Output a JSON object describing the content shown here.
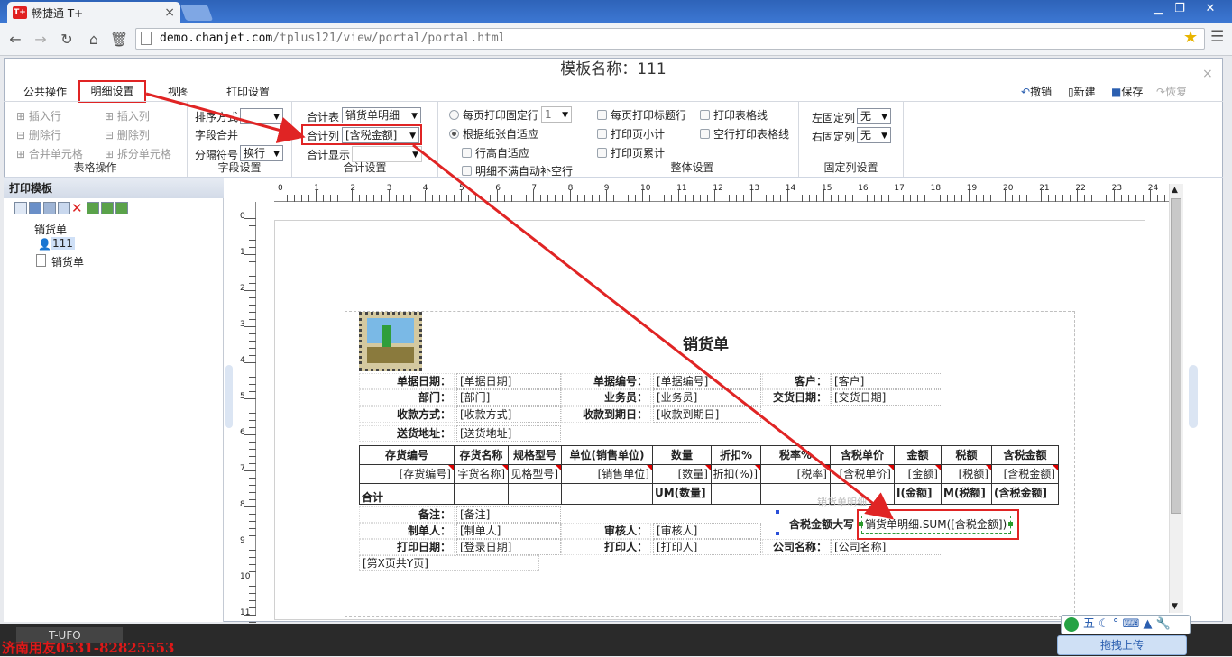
{
  "browser": {
    "tab_title": "畅捷通 T+",
    "tab_logo": "T+",
    "url_domain": "demo.chanjet.com",
    "url_path": "/tplus121/view/portal/portal.html",
    "window_controls": [
      "▁",
      "❐",
      "✕"
    ]
  },
  "app": {
    "title": "模板名称：111",
    "close": "×",
    "menu": [
      "公共操作",
      "明细设置",
      "视图",
      "打印设置"
    ],
    "actions": [
      "撤销",
      "新建",
      "保存",
      "恢复"
    ],
    "table_ops": {
      "items": [
        "插入行",
        "插入列",
        "删除行",
        "删除列",
        "合并单元格",
        "拆分单元格"
      ],
      "group": "表格操作"
    },
    "field_settings": {
      "sort_label": "排序方式",
      "sort_value": "",
      "merge_label": "字段合并",
      "sep_label": "分隔符号",
      "sep_value": "换行",
      "group": "字段设置"
    },
    "total_settings": {
      "table_label": "合计表",
      "table_value": "销货单明细",
      "col_label": "合计列",
      "col_value": "[含税金额]",
      "disp_label": "合计显示",
      "disp_value": "",
      "group": "合计设置"
    },
    "page_options": {
      "fixed_rows_label": "每页打印固定行",
      "fixed_rows_value": "1",
      "adapt_label": "根据纸张自适应",
      "row_height_label": "行高自适应",
      "fill_label": "明细不满自动补空行"
    },
    "overall": {
      "items": [
        "每页打印标题行",
        "打印表格线",
        "打印页小计",
        "空行打印表格线",
        "打印页累计"
      ],
      "group": "整体设置"
    },
    "fixed_cols": {
      "left_label": "左固定列",
      "left_value": "无",
      "right_label": "右固定列",
      "right_value": "无",
      "group": "固定列设置"
    }
  },
  "left_panel": {
    "title": "打印模板",
    "tree": [
      "销货单",
      "111",
      "销货单"
    ]
  },
  "ruler": {
    "h": [
      "0",
      "1",
      "2",
      "3",
      "4",
      "5",
      "6",
      "7",
      "8",
      "9",
      "10",
      "11",
      "12",
      "13",
      "14",
      "15",
      "16",
      "17",
      "18",
      "19",
      "20",
      "21",
      "22",
      "23",
      "24"
    ],
    "v": [
      "0",
      "1",
      "2",
      "3",
      "4",
      "5",
      "6",
      "7",
      "8",
      "9",
      "10",
      "11"
    ]
  },
  "doc": {
    "title": "销货单",
    "header_rows": [
      [
        [
          "单据日期：",
          "[单据日期]"
        ],
        [
          "单据编号：",
          "[单据编号]"
        ],
        [
          "客户：",
          "[客户]"
        ]
      ],
      [
        [
          "部门：",
          "[部门]"
        ],
        [
          "业务员：",
          "[业务员]"
        ],
        [
          "交货日期：",
          "[交货日期]"
        ]
      ],
      [
        [
          "收款方式：",
          "[收款方式]"
        ],
        [
          "收款到期日：",
          "[收款到期日]"
        ]
      ],
      [
        [
          "送货地址：",
          "[送货地址]"
        ]
      ]
    ],
    "columns": [
      "存货编号",
      "存货名称",
      "规格型号",
      "单位(销售单位)",
      "数量",
      "折扣%",
      "税率%",
      "含税单价",
      "金额",
      "税额",
      "含税金额"
    ],
    "row": [
      "[存货编号]",
      "字货名称]",
      "见格型号]",
      "[销售单位]",
      "[数量]",
      "折扣(%)]",
      "[税率]",
      "[含税单价]",
      "[金额]",
      "[税额]",
      "[含税金额]"
    ],
    "total_label": "合计",
    "total_row": [
      "",
      "",
      "",
      "",
      "UM(数量]",
      "",
      "",
      "",
      "I(金额]",
      "M(税额]",
      "(含税金额]"
    ],
    "footer_rows": [
      [
        [
          "备注：",
          "[备注]"
        ]
      ],
      [
        [
          "制单人：",
          "[制单人]"
        ],
        [
          "审核人：",
          "[审核人]"
        ]
      ],
      [
        [
          "打印日期：",
          "[登录日期]"
        ],
        [
          "打印人：",
          "[打印人]"
        ],
        [
          "公司名称：",
          "[公司名称]"
        ]
      ]
    ],
    "page_no": "[第X页共Y页]",
    "tax_total_label": "含税金额大写",
    "selected_formula": "销货单明细.SUM([含税金额])",
    "ghost_label": "销货单明细"
  },
  "taskbar": {
    "item": "T-UFO",
    "watermark": "济南用友0531-82825553",
    "ime": "五",
    "upload": "拖拽上传"
  }
}
